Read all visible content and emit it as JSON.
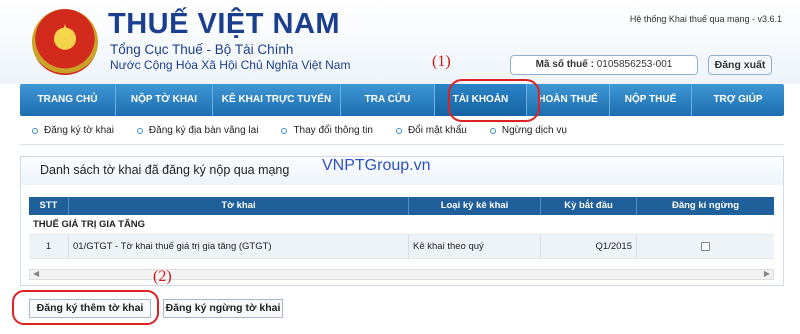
{
  "header": {
    "brand_title": "THUẾ VIỆT NAM",
    "brand_sub1": "Tổng Cục Thuế - Bộ Tài Chính",
    "brand_sub2": "Nước Cộng Hòa Xã Hội Chủ Nghĩa Việt Nam",
    "system_version": "Hệ thống Khai thuế qua mạng - v3.6.1",
    "tax_code_label": "Mã số thuế :",
    "tax_code_value": "0105856253-001",
    "logout_label": "Đăng xuất",
    "emblem_text": "CỘNG HÒA XÃ HỘI CHỦ NGHĨA VIỆT NAM"
  },
  "annotations": {
    "one": "(1)",
    "two": "(2)",
    "color": "#dd2222"
  },
  "nav": {
    "items": [
      {
        "label": "TRANG CHỦ"
      },
      {
        "label": "NỘP TỜ KHAI"
      },
      {
        "label": "KÊ KHAI TRỰC TUYẾN"
      },
      {
        "label": "TRA CỨU"
      },
      {
        "label": "TÀI KHOẢN",
        "active": true
      },
      {
        "label": "HOÀN THUẾ"
      },
      {
        "label": "NỘP THUẾ"
      },
      {
        "label": "TRỢ GIÚP"
      }
    ],
    "accent": "#1d6eae"
  },
  "subnav": {
    "items": [
      {
        "label": "Đăng ký tờ khai"
      },
      {
        "label": "Đăng ký địa bàn vãng lai"
      },
      {
        "label": "Thay đổi thông tin"
      },
      {
        "label": "Đổi mật khẩu"
      },
      {
        "label": "Ngừng dịch vụ"
      }
    ]
  },
  "panel": {
    "title": "Danh sách tờ khai đã đăng ký nộp qua mạng",
    "watermark": "VNPTGroup.vn"
  },
  "table": {
    "headers": [
      "STT",
      "Tờ khai",
      "Loại kỳ kê khai",
      "Kỳ bắt đầu",
      "Đăng kí ngừng"
    ],
    "group": "THUẾ GIÁ TRỊ GIA TĂNG",
    "rows": [
      {
        "stt": "1",
        "to_khai": "01/GTGT - Tờ khai thuế giá trị gia tăng (GTGT)",
        "loai_ky": "Kê khai theo quý",
        "ky_bat_dau": "Q1/2015",
        "dang_ki_ngung": false
      }
    ],
    "header_color": "#1f5f9a"
  },
  "buttons": {
    "add": "Đăng ký thêm tờ khai",
    "stop": "Đăng ký ngừng tờ khai"
  }
}
